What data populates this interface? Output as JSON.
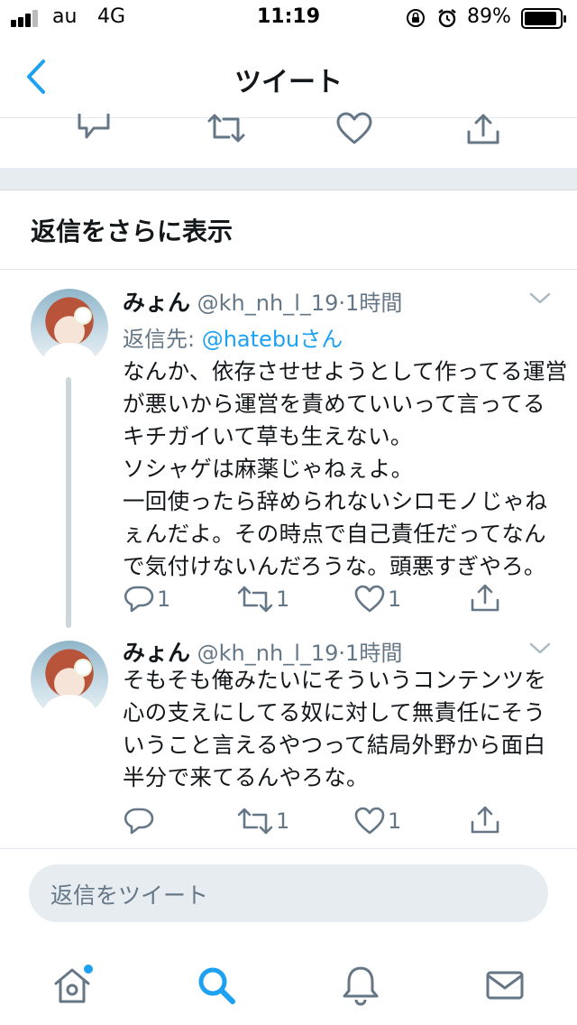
{
  "status_bar": {
    "carrier": "au",
    "network": "4G",
    "time": "11:19",
    "battery": "89%"
  },
  "nav": {
    "title": "ツイート"
  },
  "prev_actions": {},
  "show_more": {
    "label": "返信をさらに表示"
  },
  "tweets": [
    {
      "name": "みょん",
      "handle": "@kh_nh_l_19",
      "time": "1時間",
      "reply_prefix": "返信先: ",
      "reply_user": "@hatebuさん",
      "body": "なんか、依存させせようとして作ってる運営\nが悪いから運営を責めていいって言ってる\nキチガイいて草も生えない。\nソシャゲは麻薬じゃねぇよ。\n一回使ったら辞められないシロモノじゃね\nぇんだよ。その時点で自己責任だってなん\nで気付けないんだろうな。頭悪すぎやろ。",
      "reply_count": "1",
      "retweet_count": "1",
      "like_count": "1"
    },
    {
      "name": "みょん",
      "handle": "@kh_nh_l_19",
      "time": "1時間",
      "body": "そもそも俺みたいにそういうコンテンツを\n心の支えにしてる奴に対して無責任にそう\nいうこと言えるやつって結局外野から面白\n半分で来てるんやろな。",
      "reply_count": "",
      "retweet_count": "1",
      "like_count": "1"
    }
  ],
  "composer": {
    "placeholder": "返信をツイート"
  },
  "colors": {
    "accent": "#1da1f2",
    "muted": "#657786",
    "separator": "#e6ecf0"
  },
  "tab_bar": {
    "items": [
      "home-icon",
      "search-icon",
      "notifications-icon",
      "messages-icon"
    ],
    "active": "search-icon"
  }
}
